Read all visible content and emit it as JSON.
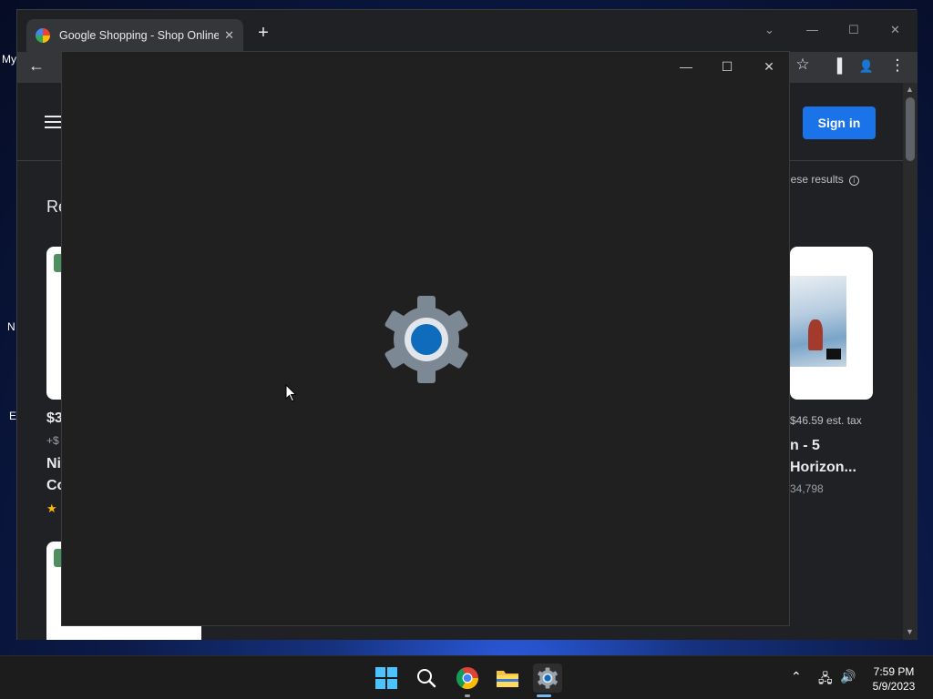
{
  "desktop": {
    "labels": [
      "My",
      "N",
      "E"
    ]
  },
  "browser": {
    "tab_title": "Google Shopping - Shop Online",
    "tab_close": "✕",
    "new_tab": "+",
    "window_controls": {
      "dropdown": "⌄",
      "minimize": "—",
      "maximize": "☐",
      "close": "✕"
    },
    "toolbar": {
      "back": "←",
      "star": "☆",
      "sidepanel": "▐",
      "profile": "👤",
      "menu": "⋮"
    },
    "page": {
      "sign_in_label": "Sign in",
      "results_note": "hese results",
      "results_info": "i",
      "section_heading": "Re",
      "left_card": {
        "price": "$3",
        "tax": "+$",
        "title_line1": "Ni",
        "title_line2": "Co",
        "star": "★"
      },
      "right_card": {
        "tax_note": "$46.59 est. tax",
        "title_line1": "n - 5",
        "title_line2": "Horizon...",
        "reviews": "34,798"
      }
    }
  },
  "settings_window": {
    "controls": {
      "minimize": "—",
      "maximize": "☐",
      "close": "✕"
    },
    "accent_color": "#0f6cbd",
    "gear_color": "#7c8894"
  },
  "taskbar": {
    "apps": [
      "start-icon",
      "search-icon",
      "chrome-icon",
      "file-explorer-icon",
      "settings-icon"
    ],
    "tray": {
      "chevron": "⌃",
      "network": "🖧",
      "volume": "🔊"
    },
    "time": "7:59 PM",
    "date": "5/9/2023"
  }
}
